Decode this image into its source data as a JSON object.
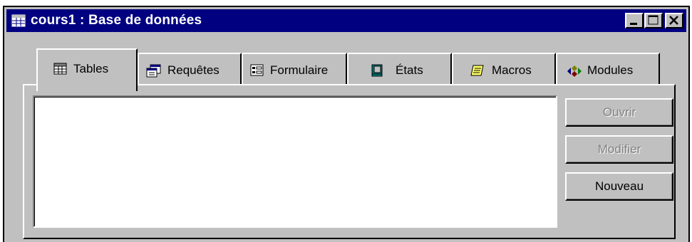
{
  "window": {
    "title": "cours1 : Base de données",
    "title_icon": "database-window-icon",
    "controls": {
      "minimize": "minimize-icon",
      "maximize": "maximize-icon",
      "close": "close-icon"
    }
  },
  "tabs": [
    {
      "label": "Tables",
      "icon": "table-icon",
      "active": true
    },
    {
      "label": "Requêtes",
      "icon": "query-icon",
      "active": false
    },
    {
      "label": "Formulaire",
      "icon": "form-icon",
      "active": false
    },
    {
      "label": "États",
      "icon": "report-icon",
      "active": false
    },
    {
      "label": "Macros",
      "icon": "macro-icon",
      "active": false
    },
    {
      "label": "Modules",
      "icon": "module-icon",
      "active": false
    }
  ],
  "buttons": {
    "open": "Ouvrir",
    "modify": "Modifier",
    "new": "Nouveau"
  },
  "colors": {
    "titlebar": "#000080",
    "face": "#c0c0c0",
    "disabled_text": "#808080"
  }
}
